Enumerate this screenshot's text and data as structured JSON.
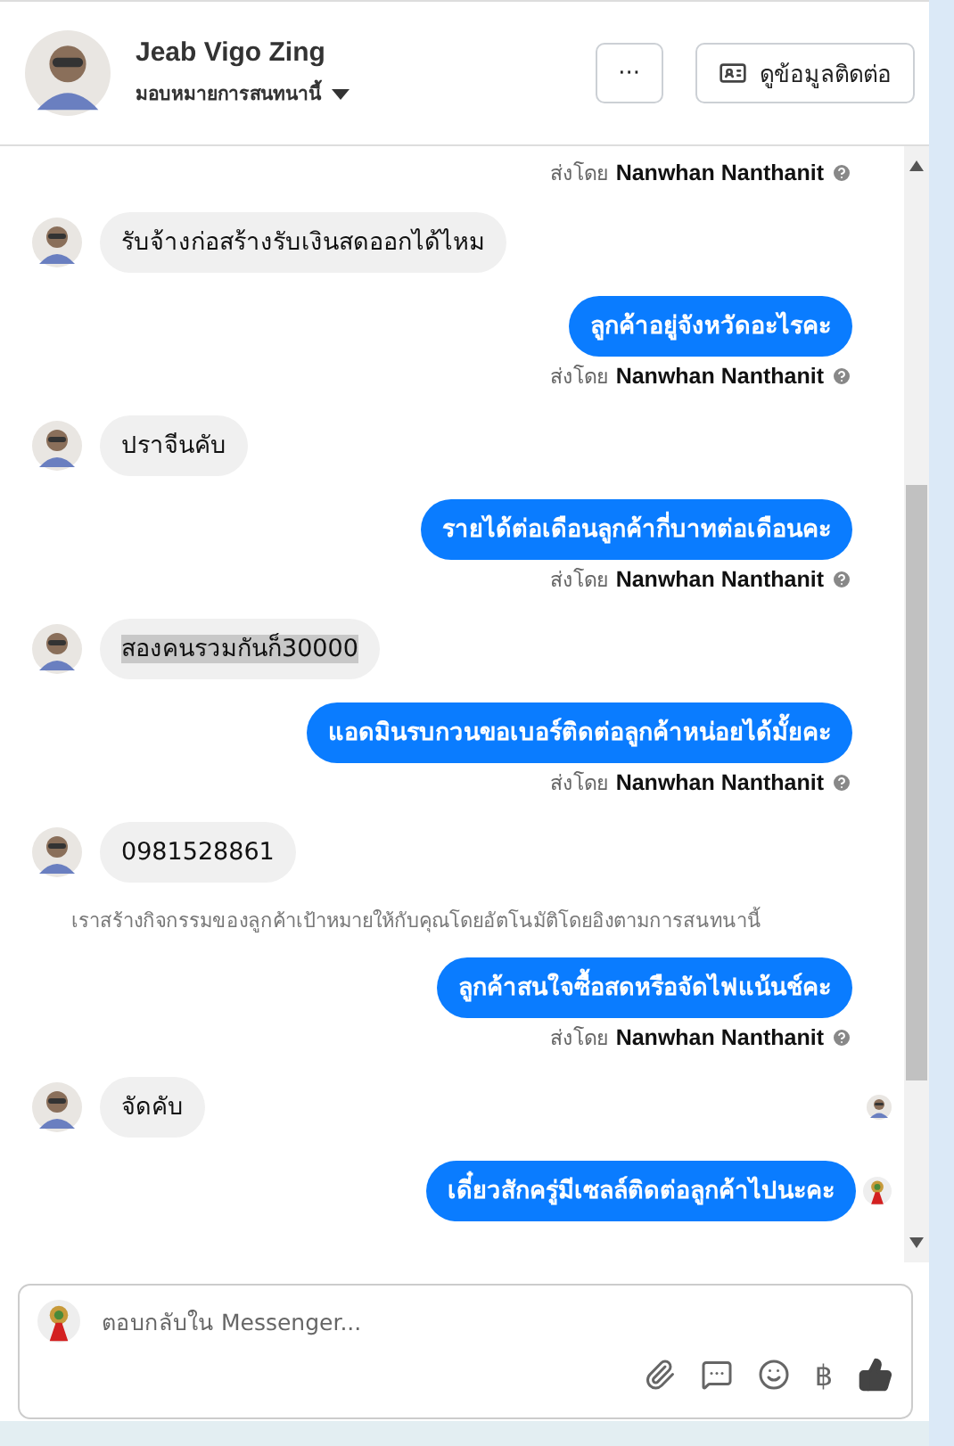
{
  "header": {
    "name": "Jeab Vigo Zing",
    "assign_label": "มอบหมายการสนทนานี้",
    "more_button": "···",
    "contact_button": "ดูข้อมูลติดต่อ"
  },
  "messages": [
    {
      "kind": "sender_note",
      "prefix": "ส่งโดย",
      "sender": "Nanwhan Nanthanit"
    },
    {
      "kind": "incoming",
      "text": "รับจ้างก่อสร้างรับเงินสดออกได้ไหม",
      "highlighted": false,
      "read_receipt": false
    },
    {
      "kind": "outgoing",
      "text": "ลูกค้าอยู่จังหวัดอะไรคะ",
      "read_receipt": false
    },
    {
      "kind": "sender_note",
      "prefix": "ส่งโดย",
      "sender": "Nanwhan Nanthanit"
    },
    {
      "kind": "incoming",
      "text": "ปราจีนคับ",
      "highlighted": false,
      "read_receipt": false
    },
    {
      "kind": "outgoing",
      "text": "รายได้ต่อเดือนลูกค้ากี่บาทต่อเดือนคะ",
      "read_receipt": false
    },
    {
      "kind": "sender_note",
      "prefix": "ส่งโดย",
      "sender": "Nanwhan Nanthanit"
    },
    {
      "kind": "incoming",
      "text": "สองคนรวมกันก็30000",
      "highlighted": true,
      "read_receipt": false
    },
    {
      "kind": "outgoing",
      "text": "แอดมินรบกวนขอเบอร์ติดต่อลูกค้าหน่อยได้มั้ยคะ",
      "read_receipt": false
    },
    {
      "kind": "sender_note",
      "prefix": "ส่งโดย",
      "sender": "Nanwhan Nanthanit"
    },
    {
      "kind": "incoming",
      "text": "0981528861",
      "highlighted": false,
      "read_receipt": false
    },
    {
      "kind": "system_note",
      "text": "เราสร้างกิจกรรมของลูกค้าเป้าหมายให้กับคุณโดยอัตโนมัติโดยอิงตามการสนทนานี้"
    },
    {
      "kind": "outgoing",
      "text": "ลูกค้าสนใจซื้อสดหรือจัดไฟแน้นช์คะ",
      "read_receipt": false
    },
    {
      "kind": "sender_note",
      "prefix": "ส่งโดย",
      "sender": "Nanwhan Nanthanit"
    },
    {
      "kind": "incoming",
      "text": "จัดคับ",
      "highlighted": false,
      "read_receipt": true
    },
    {
      "kind": "outgoing",
      "text": "เดี๋ยวสักครู่มีเซลล์ติดต่อลูกค้าไปนะคะ",
      "read_receipt": true
    }
  ],
  "composer": {
    "placeholder": "ตอบกลับใน Messenger...",
    "currency_symbol": "฿"
  }
}
